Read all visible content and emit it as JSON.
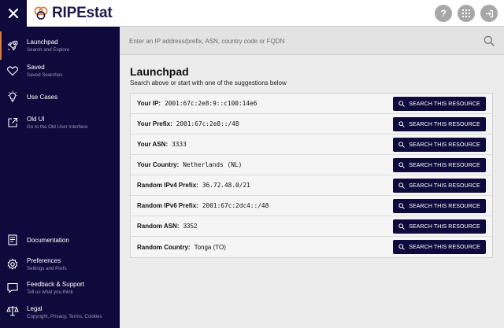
{
  "header": {
    "logo_text": "RIPEstat",
    "help_label": "?"
  },
  "sidebar": {
    "items": [
      {
        "title": "Launchpad",
        "subtitle": "Search and Explore",
        "icon": "rocket-icon"
      },
      {
        "title": "Saved",
        "subtitle": "Saved Searches",
        "icon": "heart-icon"
      },
      {
        "title": "Use Cases",
        "subtitle": "",
        "icon": "lightbulb-icon"
      },
      {
        "title": "Old UI",
        "subtitle": "Go to the Old User Interface",
        "icon": "external-link-icon"
      },
      {
        "title": "Documentation",
        "subtitle": "",
        "icon": "document-icon"
      },
      {
        "title": "Preferences",
        "subtitle": "Settings and Prefs",
        "icon": "gear-icon"
      },
      {
        "title": "Feedback & Support",
        "subtitle": "Tell us what you think",
        "icon": "chat-icon"
      },
      {
        "title": "Legal",
        "subtitle": "Copyright, Privacy, Terms, Cookies",
        "icon": "scale-icon"
      }
    ]
  },
  "search": {
    "placeholder": "Enter an IP address/prefix, ASN, country code or FQDN",
    "value": ""
  },
  "main": {
    "title": "Launchpad",
    "subtitle": "Search above or start with one of the suggestions below",
    "button_label": "SEARCH THIS RESOURCE",
    "rows": [
      {
        "label": "Your IP:",
        "value": "2001:67c:2e8:9::c100:14e6",
        "mono": true
      },
      {
        "label": "Your Prefix:",
        "value": "2001:67c:2e8::/48",
        "mono": true
      },
      {
        "label": "Your ASN:",
        "value": "3333",
        "mono": true
      },
      {
        "label": "Your Country:",
        "value": "Netherlands (NL)",
        "mono": true
      },
      {
        "label": "Random IPv4 Prefix:",
        "value": "36.72.48.0/21",
        "mono": true
      },
      {
        "label": "Random IPv6 Prefix:",
        "value": "2001:67c:2dc4::/48",
        "mono": true
      },
      {
        "label": "Random ASN:",
        "value": "3352",
        "mono": false
      },
      {
        "label": "Random Country:",
        "value": "Tonga (TO)",
        "mono": false
      }
    ]
  },
  "colors": {
    "navy": "#0f0a3c",
    "accent": "#e07a3a"
  }
}
